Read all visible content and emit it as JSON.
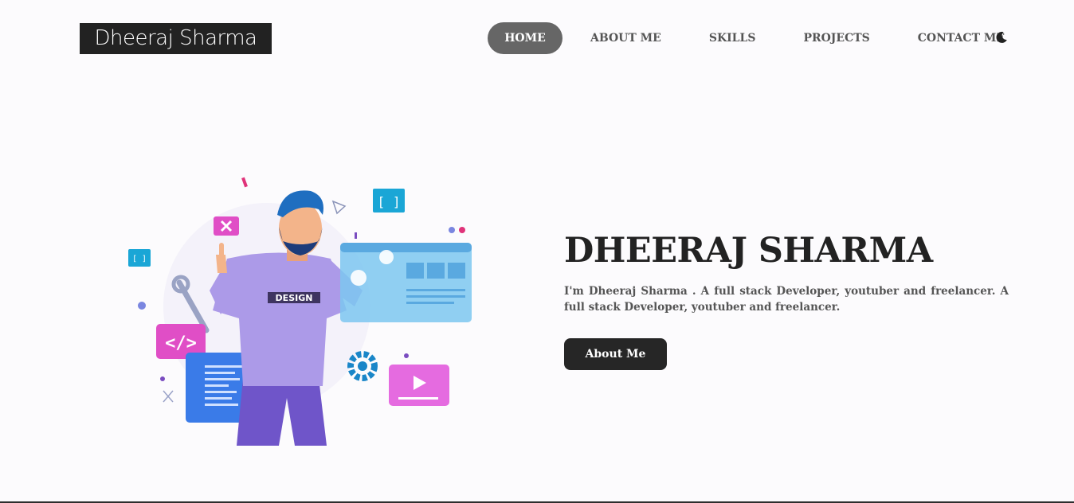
{
  "header": {
    "logo_text": "Dheeraj Sharma",
    "nav": [
      {
        "label": "HOME",
        "active": true
      },
      {
        "label": "ABOUT ME",
        "active": false
      },
      {
        "label": "SKILLS",
        "active": false
      },
      {
        "label": "PROJECTS",
        "active": false
      },
      {
        "label": "CONTACT ME",
        "active": false
      }
    ],
    "theme_toggle_icon": "moon-icon"
  },
  "hero": {
    "illustration_badge": "DESIGN",
    "title": "DHEERAJ SHARMA",
    "description": "I'm Dheeraj Sharma . A full stack Developer, youtuber and freelancer. A full stack Developer, youtuber and freelancer.",
    "button_label": "About Me"
  },
  "colors": {
    "background": "#fcfbfd",
    "dark": "#222222",
    "nav_active_bg": "#666666",
    "nav_text": "#555555",
    "button_bg": "#262626"
  }
}
